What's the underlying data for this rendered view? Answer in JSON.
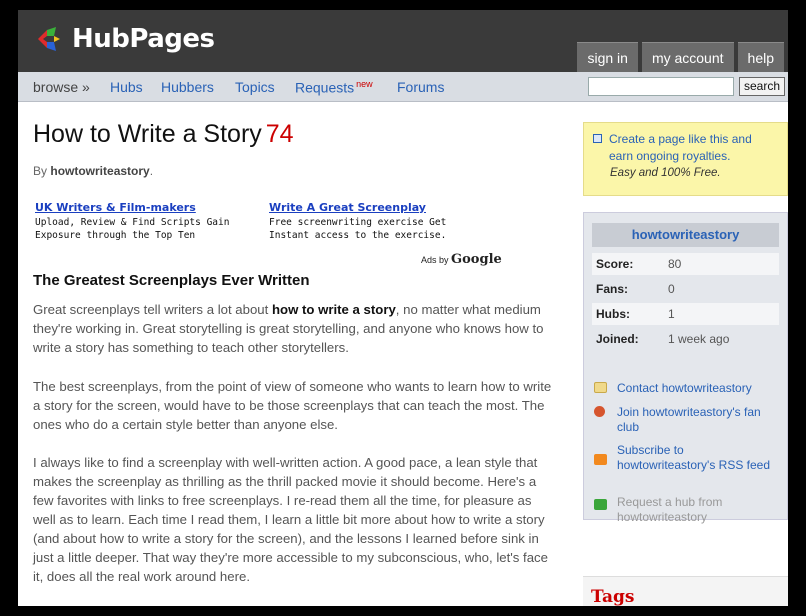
{
  "header": {
    "app_name": "HubPages",
    "top_nav": [
      "sign in",
      "my account",
      "help"
    ]
  },
  "subnav": {
    "browse": "browse »",
    "items": [
      "Hubs",
      "Hubbers",
      "Topics",
      "Requests",
      "Forums"
    ],
    "new_badge": "new",
    "search_value": "",
    "search_button": "search"
  },
  "article": {
    "title": "How to Write a Story",
    "score": "74",
    "by_prefix": "By",
    "author": "howtowriteastory",
    "by_suffix": ".",
    "section_heading": "The Greatest Screenplays Ever Written",
    "para1_pre": "Great screenplays tell writers a lot about ",
    "para1_bold": "how to write a story",
    "para1_post": ", no matter what medium they're working in. Great storytelling is great storytelling, and anyone who knows how to write a story has something to teach other storytellers.",
    "para2": "The best screenplays, from the point of view of someone who wants to learn how to write a story for the screen, would have to be those screenplays that can teach the most. The ones who do a certain style better than anyone else.",
    "para3": "I always like to find a screenplay with well-written action. A good pace, a lean style that makes the screenplay as thrilling as the thrill packed movie it should become. Here's a few favorites with links to free screenplays. I re-read them all the time, for pleasure as well as to learn. Each time I read them, I learn a little bit more about how to write a story (and about how to write a story for the screen), and the lessons I learned before sink in just a little deeper. That way they're more accessible to my subconscious, who, let's face it, does all the real work around here."
  },
  "ads": [
    {
      "title": "UK Writers & Film-makers",
      "text": "Upload, Review & Find Scripts Gain Exposure through the Top Ten"
    },
    {
      "title": "Write A Great Screenplay",
      "text": "Free screenwriting exercise Get Instant access to the exercise."
    }
  ],
  "ads_by": "Ads by",
  "ads_brand": "Google",
  "sidebar": {
    "promo_link": "Create a page like this and earn ongoing royalties.",
    "promo_note": "Easy and 100% Free.",
    "profile_name": "howtowriteastory",
    "stats": [
      {
        "label": "Score:",
        "value": "80"
      },
      {
        "label": "Fans:",
        "value": "0"
      },
      {
        "label": "Hubs:",
        "value": "1"
      },
      {
        "label": "Joined:",
        "value": "1 week ago"
      }
    ],
    "links": [
      {
        "text": "Contact howtowriteastory",
        "icon": "envelope-icon",
        "color": "#e8c86a"
      },
      {
        "text": "Join howtowriteastory's fan club",
        "icon": "fan-club-icon",
        "color": "#d6552e"
      },
      {
        "text": "Subscribe to howtowriteastory's RSS feed",
        "icon": "rss-icon",
        "color": "#f2891e"
      },
      {
        "text": "Request a hub from howtowriteastory",
        "icon": "request-icon",
        "color": "#3aa63a"
      }
    ],
    "tags_title": "Tags"
  },
  "colors": {
    "header_bg": "#3a3a3a",
    "link_blue": "#2a62b6",
    "score_red": "#cc0000",
    "promo_yellow": "#fbf6a9"
  }
}
